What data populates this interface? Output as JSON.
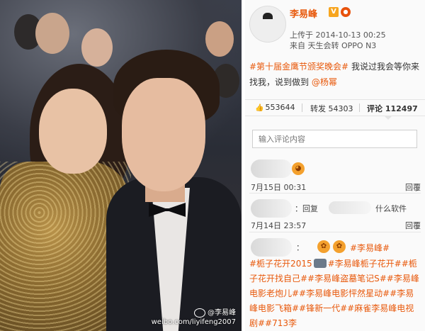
{
  "photo": {
    "watermark_user": "@李易峰",
    "watermark_url": "weibo.com/liyifeng2007"
  },
  "post": {
    "username": "李易峰",
    "v_badge": "V",
    "upload_line": "上传于 2014-10-13 00:25",
    "source_line": "来自 天生会转 OPPO N3",
    "hashtag": "#第十届金鹰节颁奖晚会#",
    "text": "我说过我会等你来找我，说到做到",
    "mention": "@杨幂"
  },
  "actions": {
    "likes": "553644",
    "forward_label": "转发",
    "forward_count": "54303",
    "comment_label": "评论",
    "comment_count": "112497"
  },
  "comment_input": {
    "placeholder": "输入评论内容"
  },
  "comments": [
    {
      "time": "7月15日 00:31",
      "reply_label": "回覆"
    },
    {
      "prefix": "：回复",
      "text": "什么软件",
      "time": "7月14日 23:57",
      "reply_label": "回覆"
    },
    {
      "prefix": "：",
      "hashtag1": "#李易峰#",
      "hashtag2": "#栀子花开2015",
      "rest": "#李易峰栀子花开##栀子花开找自己##李易峰盗墓笔记S##李易峰电影老炮儿##李易峰电影怦然星动##李易峰电影飞箱##锋新一代##麻雀李易峰电视剧##713李"
    }
  ],
  "colors": {
    "accent": "#e8590c",
    "text": "#333333"
  }
}
